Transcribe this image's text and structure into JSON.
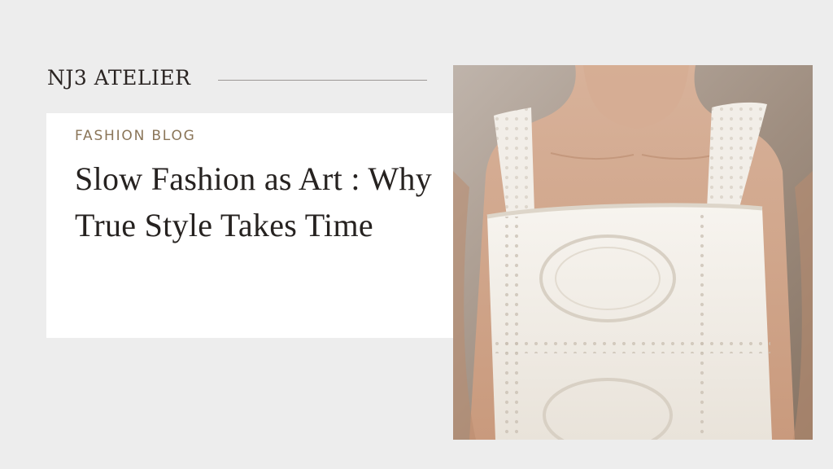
{
  "brand": {
    "name": "NJ3 ATELIER"
  },
  "card": {
    "eyebrow": "FASHION BLOG",
    "title": "Slow Fashion as Art : Why True Style Takes Time"
  },
  "image": {
    "subject": "white-eyelet-lace-dress"
  },
  "colors": {
    "background": "#ededed",
    "card": "#ffffff",
    "eyebrow": "#8a7558",
    "text": "#262220"
  }
}
